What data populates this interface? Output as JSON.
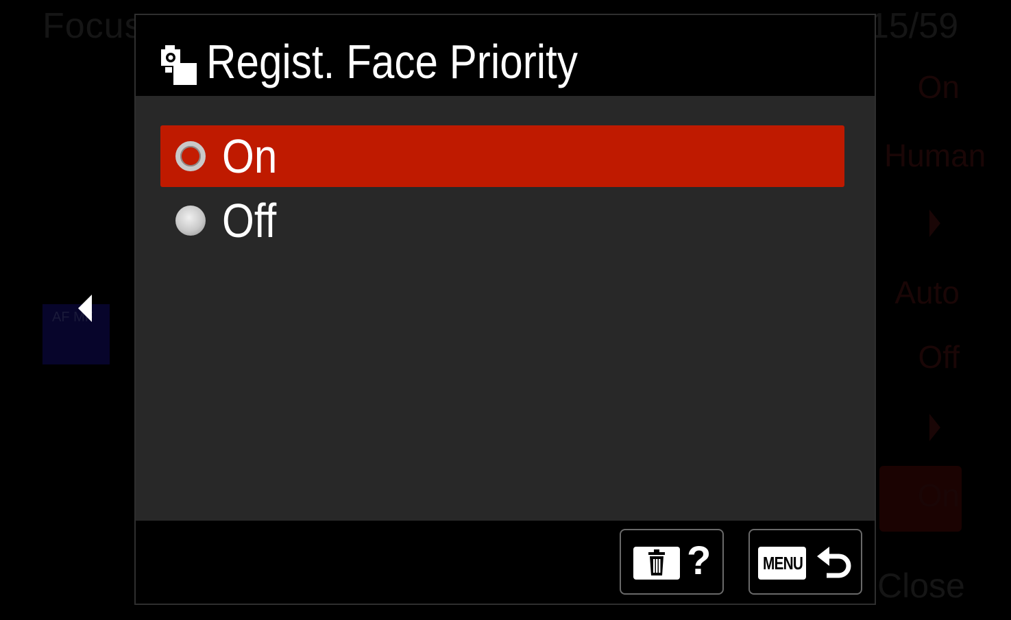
{
  "background_menu": {
    "title": "Focus",
    "page_indicator": "15/59",
    "values": [
      "On",
      "Human",
      "Auto",
      "Off",
      "On"
    ],
    "af_label": "AF MF",
    "close_label": "Close"
  },
  "dialog": {
    "title": "Regist. Face Priority",
    "title_icon": "registered-face-icon",
    "options": [
      {
        "label": "On",
        "selected": true
      },
      {
        "label": "Off",
        "selected": false
      }
    ],
    "footer": {
      "help_button": {
        "icon": "trash-icon",
        "label": "?"
      },
      "back_button": {
        "key_label": "MENU",
        "icon": "return-arrow-icon"
      }
    }
  },
  "colors": {
    "selection": "#bf1a00",
    "panel": "#282828",
    "background": "#000000"
  }
}
